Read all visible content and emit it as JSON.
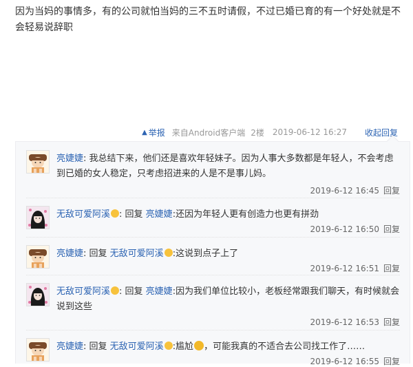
{
  "post": {
    "content": "因为当妈的事情多，有的公司就怕当妈的三不五时请假，不过已婚已育的有一个好处就是不会轻易说辞职"
  },
  "meta": {
    "report": "举报",
    "source": "来自Android客户端",
    "floor": "2楼",
    "time": "2019-06-12 16:27",
    "collapse": "收起回复"
  },
  "replies": [
    {
      "user": "亮婕婕",
      "sep": ": ",
      "reply_word": "",
      "target": "",
      "target_emoji": false,
      "text": "我总结下来，他们还是喜欢年轻妹子。因为人事大多数都是年轻人，不会考虑到已婚的女人稳定，只考虑招进来的人是不是事儿妈。",
      "time": "2019-6-12 16:45",
      "reply_label": "回复",
      "user_emoji": false,
      "avatar": "girl-avatar-icon"
    },
    {
      "user": "无敌可爱阿溪",
      "sep": ": ",
      "reply_word": "回复 ",
      "target": "亮婕婕",
      "target_emoji": false,
      "text": ":还因为年轻人更有创造力也更有拼劲",
      "time": "2019-6-12 16:50",
      "reply_label": "回复",
      "user_emoji": true,
      "avatar": "dark-hair-avatar-icon"
    },
    {
      "user": "亮婕婕",
      "sep": ": ",
      "reply_word": "回复 ",
      "target": "无敌可爱阿溪",
      "target_emoji": true,
      "text": ":这说到点子上了",
      "time": "2019-6-12 16:51",
      "reply_label": "回复",
      "user_emoji": false,
      "avatar": "girl-avatar-icon"
    },
    {
      "user": "无敌可爱阿溪",
      "sep": ": ",
      "reply_word": "回复 ",
      "target": "亮婕婕",
      "target_emoji": false,
      "text": ":因为我们单位比较小，老板经常跟我们聊天，有时候就会说到这些",
      "time": "2019-6-12 16:53",
      "reply_label": "回复",
      "user_emoji": true,
      "avatar": "dark-hair-avatar-icon"
    },
    {
      "user": "亮婕婕",
      "sep": ": ",
      "reply_word": "回复 ",
      "target": "无敌可爱阿溪",
      "target_emoji": true,
      "text": ":尴尬",
      "text_after": "，可能我真的不适合去公司找工作了……",
      "time": "2019-6-12 16:55",
      "reply_label": "回复",
      "user_emoji": false,
      "avatar": "girl-avatar-icon"
    }
  ],
  "colors": {
    "link": "#2d64b3",
    "meta_gray": "#999999",
    "panel_bg": "#f7f8fa"
  }
}
